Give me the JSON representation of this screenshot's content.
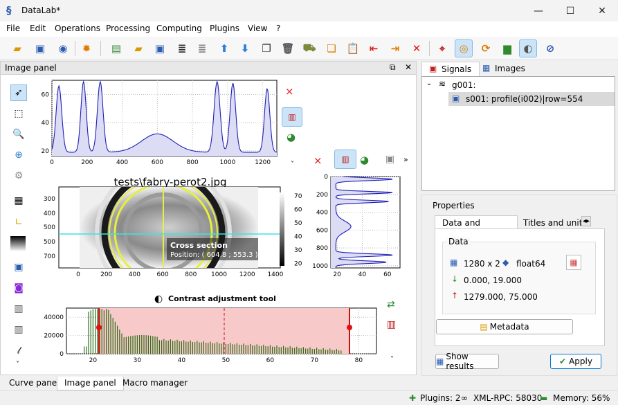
{
  "window": {
    "title": "DataLab*",
    "minimize": "—",
    "maximize": "☐",
    "close": "✕"
  },
  "menu": [
    "File",
    "Edit",
    "Operations",
    "Processing",
    "Computing",
    "Plugins",
    "View",
    "?"
  ],
  "image_panel": {
    "title": "Image panel",
    "restore": "⧉",
    "close": "✕",
    "image_title": "tests\\fabry-perot2.jpg",
    "cross_section_title": "Cross section",
    "cross_section_pos": "Position: ( 604.8 ; 553.3 )",
    "contrast_title": "Contrast adjustment tool",
    "more": "»",
    "ellipsis": "˅"
  },
  "profile_x": {
    "ticks_x": [
      "0",
      "200",
      "400",
      "600",
      "800",
      "1000",
      "1200"
    ],
    "ticks_y": [
      "60",
      "40",
      "20"
    ]
  },
  "image_axes": {
    "ticks_x": [
      "0",
      "200",
      "400",
      "600",
      "800",
      "1000",
      "1200",
      "1400"
    ],
    "ticks_y": [
      "300",
      "400",
      "500",
      "500",
      "700"
    ],
    "colorbar": [
      "70",
      "60",
      "50",
      "40",
      "30",
      "20"
    ]
  },
  "profile_y": {
    "ticks_x": [
      "20",
      "40",
      "60"
    ],
    "ticks_y": [
      "0",
      "200",
      "400",
      "600",
      "800",
      "1000"
    ]
  },
  "histogram": {
    "ticks_x": [
      "20",
      "30",
      "40",
      "50",
      "60",
      "70",
      "80"
    ],
    "ticks_y": [
      "40000",
      "20000",
      "0"
    ]
  },
  "bottom_tabs": [
    "Curve panel",
    "Image panel",
    "Macro manager"
  ],
  "right": {
    "tab_signals": "Signals",
    "tab_images": "Images",
    "group": "g001:",
    "signal": "s001: profile(i002)|row=554",
    "properties": "Properties",
    "tab_data": "Data and metadata",
    "tab_titles": "Titles and units",
    "data_label": "Data",
    "shape": "1280 x 2",
    "dtype": "float64",
    "min": "0.000, 19.000",
    "max": "1279.000, 75.000",
    "metadata_btn": "Metadata",
    "show_results": "Show results",
    "apply": "Apply"
  },
  "status": {
    "plugins": "Plugins: 2",
    "xmlrpc": "XML-RPC: 58030",
    "memory": "Memory: 56%"
  },
  "colors": {
    "accent": "#0078d4",
    "curve": "#1f1fb4",
    "curve_fill": "#dcdcf5",
    "histbar": "#2f6e1a",
    "range": "#f7c9c9",
    "cross": "#3de3e3",
    "ring": "#e8ef3c"
  }
}
